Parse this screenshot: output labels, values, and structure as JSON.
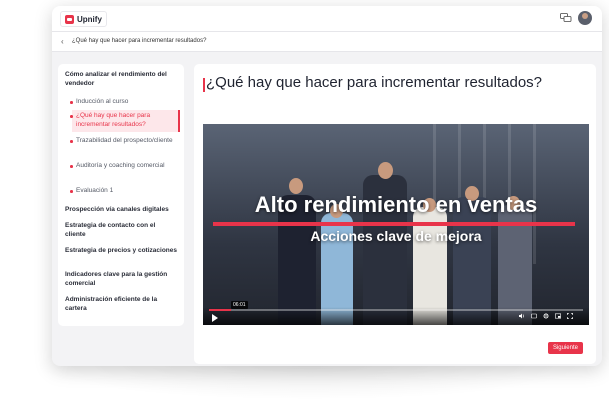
{
  "app": {
    "name": "Upnify"
  },
  "breadcrumb": {
    "text": "¿Qué hay que hacer para incrementar resultados?"
  },
  "sidebar": {
    "sections": [
      {
        "label": "Cómo analizar el rendimiento del vendedor",
        "children": [
          "Inducción al curso",
          "¿Qué hay que hacer para incrementar resultados?",
          "Trazabilidad del prospecto/cliente",
          "Auditoría y coaching comercial",
          "Evaluación 1"
        ]
      },
      {
        "label": "Prospección vía canales digitales"
      },
      {
        "label": "Estrategia de contacto con el cliente"
      },
      {
        "label": "Estrategia de precios y cotizaciones"
      },
      {
        "label": "Indicadores clave para la gestión comercial"
      },
      {
        "label": "Administración eficiente de la cartera"
      }
    ]
  },
  "main": {
    "title": "¿Qué hay que hacer para incrementar resultados?",
    "video": {
      "title": "Alto rendimiento en ventas",
      "subtitle": "Acciones clave de mejora",
      "time": "06:01",
      "progress": 0.06
    },
    "next_label": "Siguiente"
  },
  "colors": {
    "accent": "#e8344a",
    "dark": "#1f2330"
  },
  "icons": [
    "logo-icon",
    "chat-icon",
    "avatar",
    "back-icon",
    "play-icon",
    "volume-icon",
    "cc-icon",
    "settings-icon",
    "pip-icon",
    "fullscreen-icon"
  ]
}
